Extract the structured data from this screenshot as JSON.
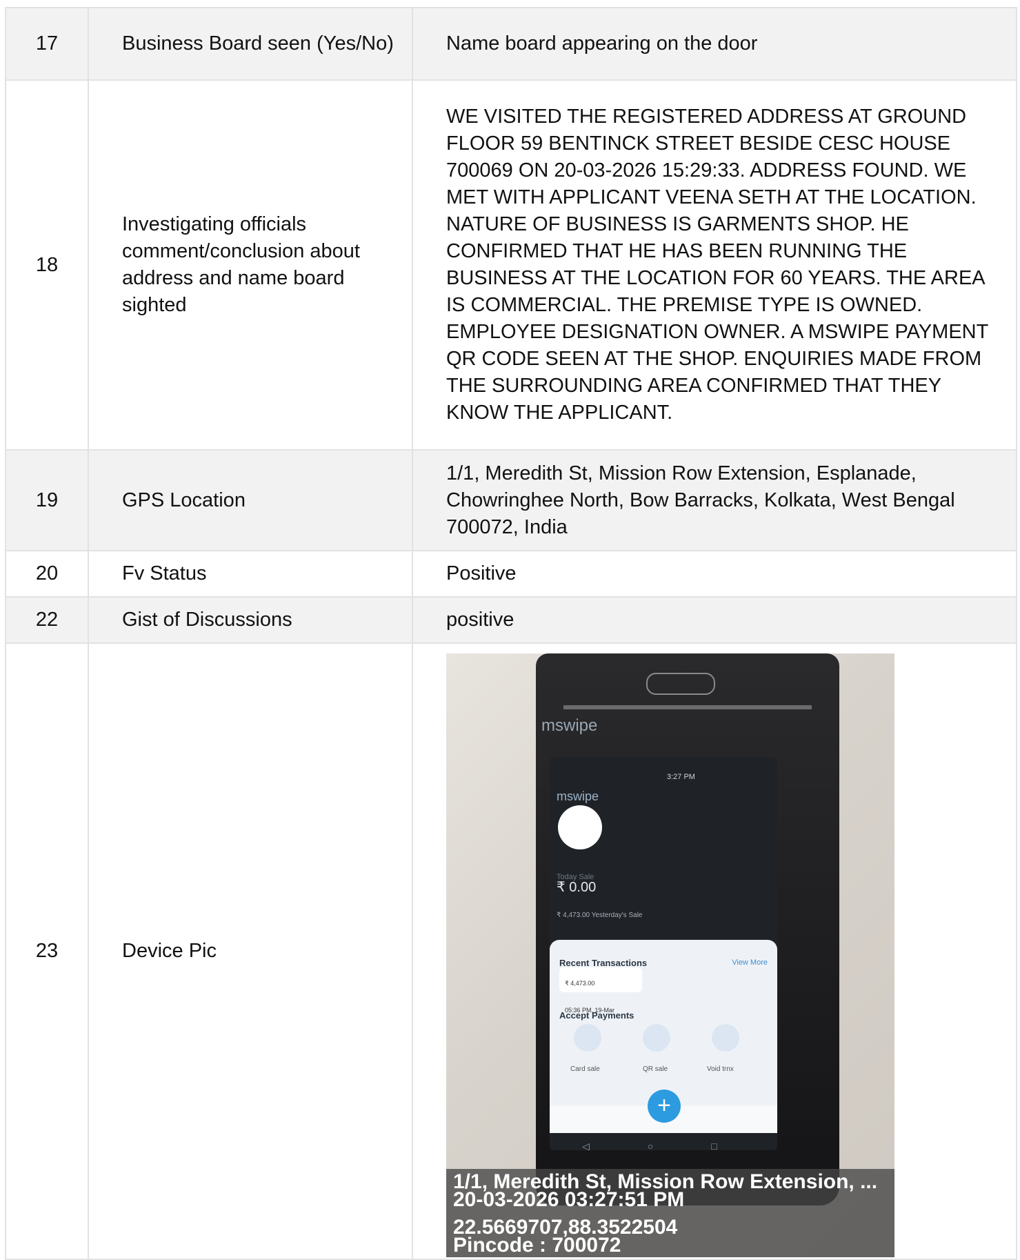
{
  "rows": [
    {
      "num": "17",
      "label": "Business Board seen (Yes/No)",
      "value": "Name board appearing on the door"
    },
    {
      "num": "18",
      "label": "Investigating officials comment/conclusion about address and name board sighted",
      "value": "WE VISITED THE REGISTERED ADDRESS AT GROUND FLOOR 59 BENTINCK STREET BESIDE CESC HOUSE 700069 ON 20-03-2026 15:29:33. ADDRESS FOUND. WE MET WITH APPLICANT VEENA SETH AT THE LOCATION. NATURE OF BUSINESS IS GARMENTS SHOP. HE CONFIRMED THAT HE HAS BEEN RUNNING THE BUSINESS AT THE LOCATION FOR 60 YEARS. THE AREA IS COMMERCIAL. THE PREMISE TYPE IS OWNED. EMPLOYEE DESIGNATION OWNER. A MSWIPE PAYMENT QR CODE SEEN AT THE SHOP. ENQUIRIES MADE FROM THE SURROUNDING AREA CONFIRMED THAT THEY KNOW THE APPLICANT."
    },
    {
      "num": "19",
      "label": "GPS Location",
      "value": "1/1, Meredith St, Mission Row Extension, Esplanade, Chowringhee North, Bow Barracks, Kolkata, West Bengal 700072, India"
    },
    {
      "num": "20",
      "label": "Fv Status",
      "value": "Positive"
    },
    {
      "num": "22",
      "label": "Gist of Discussions",
      "value": "positive"
    },
    {
      "num": "23",
      "label": "Device Pic",
      "value": ""
    }
  ],
  "photo": {
    "device_brand": "mswipe",
    "screen": {
      "status_time": "3:27 PM",
      "app_brand": "mswipe",
      "today_label": "Today Sale",
      "today_amount": "₹ 0.00",
      "yesterday": "₹ 4,473.00  Yesterday's Sale",
      "recent_title": "Recent Transactions",
      "view_more": "View More",
      "tx_amount": "₹ 4,473.00",
      "tx_time": "05:36 PM, 19-Mar",
      "accept_title": "Accept Payments",
      "action_card": "Card sale",
      "action_qr": "QR sale",
      "action_void": "Void trnx",
      "fab_symbol": "+",
      "sys_nav": "◁ ○ □"
    },
    "overlay": {
      "line1": "1/1, Meredith St, Mission Row Extension, ...",
      "line2": "20-03-2026 03:27:51 PM",
      "line3": "22.5669707,88.3522504",
      "line4": "Pincode : 700072"
    }
  }
}
